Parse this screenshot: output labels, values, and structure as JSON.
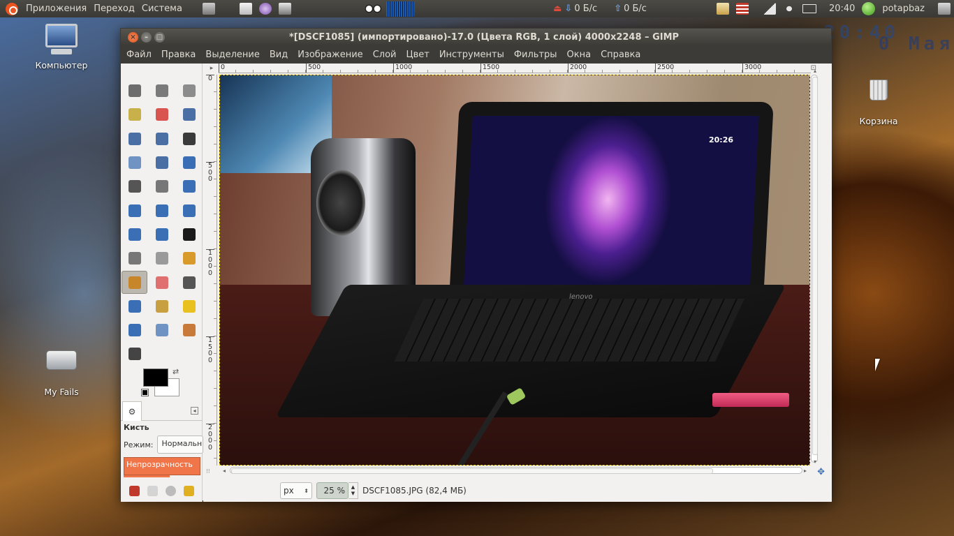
{
  "panel": {
    "menus": [
      "Приложения",
      "Переход",
      "Система"
    ],
    "net_down": "0 Б/с",
    "net_up": "0 Б/с",
    "time": "20:40",
    "user": "potapbaz",
    "icons": [
      "ubuntu-logo-icon",
      "terminal-icon",
      "notes-icon",
      "pidgin-icon",
      "camera-icon",
      "eyes-icon",
      "audio-meter-icon",
      "network-monitor-icon",
      "clipboard-icon",
      "keyboard-flag-icon",
      "signal-icon",
      "volume-icon",
      "mail-icon",
      "status-icon",
      "power-icon"
    ]
  },
  "desktop": {
    "computer_label": "Компьютер",
    "myfails_label": "My Fails",
    "trash_label": "Корзина",
    "clock_time": "20:40",
    "clock_date": "0 Мая"
  },
  "window": {
    "title": "*[DSCF1085] (импортировано)-17.0 (Цвета RGB, 1 слой) 4000x2248 – GIMP",
    "menus": [
      "Файл",
      "Правка",
      "Выделение",
      "Вид",
      "Изображение",
      "Слой",
      "Цвет",
      "Инструменты",
      "Фильтры",
      "Окна",
      "Справка"
    ]
  },
  "toolbox": {
    "tools": [
      {
        "name": "rect-select-tool",
        "color": "#6d6d6d"
      },
      {
        "name": "ellipse-select-tool",
        "color": "#7a7a7a"
      },
      {
        "name": "free-select-tool",
        "color": "#8c8c8c"
      },
      {
        "name": "fuzzy-select-tool",
        "color": "#c8b04a"
      },
      {
        "name": "color-select-tool",
        "color": "#d9534f"
      },
      {
        "name": "scissors-tool",
        "color": "#4a6fa5"
      },
      {
        "name": "foreground-select-tool",
        "color": "#4a6fa5"
      },
      {
        "name": "paths-tool",
        "color": "#4a6fa5"
      },
      {
        "name": "color-picker-tool",
        "color": "#3a3a3a"
      },
      {
        "name": "zoom-tool",
        "color": "#6f94c4"
      },
      {
        "name": "measure-tool",
        "color": "#4a6fa5"
      },
      {
        "name": "move-tool",
        "color": "#3a6fb5"
      },
      {
        "name": "align-tool",
        "color": "#555555"
      },
      {
        "name": "crop-tool",
        "color": "#777777"
      },
      {
        "name": "rotate-tool",
        "color": "#3a6fb5"
      },
      {
        "name": "scale-tool",
        "color": "#3a6fb5"
      },
      {
        "name": "shear-tool",
        "color": "#3a6fb5"
      },
      {
        "name": "perspective-tool",
        "color": "#3a6fb5"
      },
      {
        "name": "flip-tool",
        "color": "#3a6fb5"
      },
      {
        "name": "cage-tool",
        "color": "#3a6fb5"
      },
      {
        "name": "text-tool",
        "color": "#1a1a1a"
      },
      {
        "name": "bucket-fill-tool",
        "color": "#777777"
      },
      {
        "name": "blend-tool",
        "color": "#9a9a9a"
      },
      {
        "name": "pencil-tool",
        "color": "#d89a2a"
      },
      {
        "name": "paintbrush-tool",
        "color": "#c8862a"
      },
      {
        "name": "eraser-tool",
        "color": "#e07070"
      },
      {
        "name": "airbrush-tool",
        "color": "#555555"
      },
      {
        "name": "ink-tool",
        "color": "#3a6fb5"
      },
      {
        "name": "clone-tool",
        "color": "#c8a040"
      },
      {
        "name": "heal-tool",
        "color": "#e8c020"
      },
      {
        "name": "perspective-clone-tool",
        "color": "#3a6fb5"
      },
      {
        "name": "blur-tool",
        "color": "#6f94c4"
      },
      {
        "name": "smudge-tool",
        "color": "#c87a3a"
      },
      {
        "name": "dodge-burn-tool",
        "color": "#444444"
      }
    ],
    "active_index": 24,
    "tool_name": "Кисть",
    "mode_label": "Режим:",
    "mode_value": "Нормальный",
    "opacity_label": "Непрозрачность",
    "bottom_icons": [
      "save-options-icon",
      "restore-options-icon",
      "delete-options-icon",
      "reset-options-icon"
    ]
  },
  "canvas": {
    "hruler_ticks": [
      "0",
      "500",
      "1000",
      "1500",
      "2000",
      "2500",
      "3000"
    ],
    "vruler_ticks": [
      "0",
      "5\n0\n0",
      "1\n0\n0\n0",
      "1\n5\n0\n0",
      "2\n0\n0\n0"
    ],
    "screen_clock": "20:26",
    "brand": "lenovo"
  },
  "status": {
    "unit": "px",
    "zoom": "25 %",
    "file_info": "DSCF1085.JPG (82,4 МБ)"
  }
}
